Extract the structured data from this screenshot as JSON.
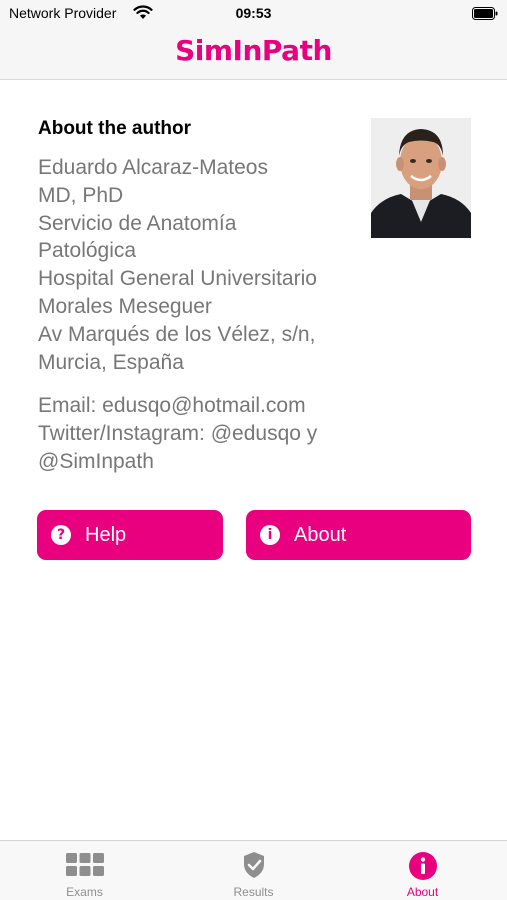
{
  "status_bar": {
    "carrier": "Network Provider",
    "time": "09:53"
  },
  "header": {
    "logo": "SimInPath"
  },
  "author": {
    "section_title": "About the author",
    "bio_lines": [
      "Eduardo Alcaraz-Mateos",
      "MD, PhD",
      "Servicio de Anatomía",
      "Patológica",
      "Hospital General Universitario",
      "Morales Meseguer",
      "Av Marqués de los Vélez, s/n,",
      "Murcia, España"
    ],
    "contact_lines": [
      "Email: edusqo@hotmail.com",
      "Twitter/Instagram: @edusqo y",
      "@SimInpath"
    ]
  },
  "buttons": {
    "help_label": "Help",
    "about_label": "About"
  },
  "tab_bar": {
    "active_tab": "About",
    "tabs": [
      {
        "label": "Exams",
        "icon": "grid-icon"
      },
      {
        "label": "Results",
        "icon": "shield-check-icon"
      },
      {
        "label": "About",
        "icon": "info-icon"
      }
    ]
  },
  "colors": {
    "accent": "#e8007f",
    "body_text": "#777777",
    "inactive_tab": "#8e8e8e"
  }
}
